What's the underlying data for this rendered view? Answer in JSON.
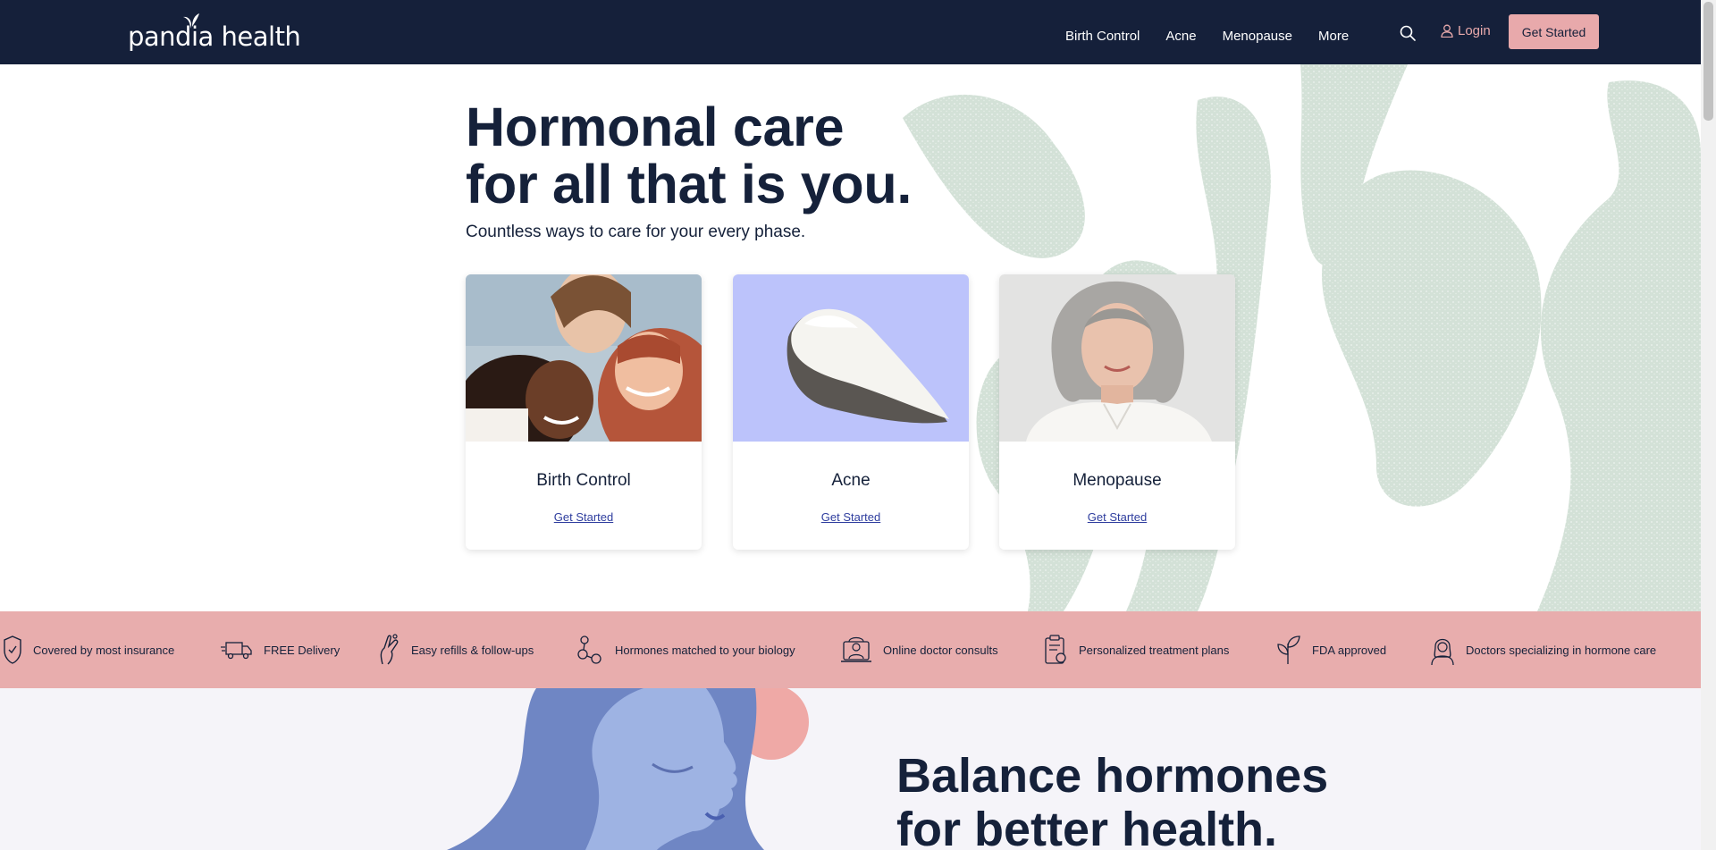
{
  "brand": {
    "logo_text": "pandia health",
    "nav_bg": "#15203a",
    "accent_pink": "#e8a9ab"
  },
  "nav": {
    "links": [
      "Birth Control",
      "Acne",
      "Menopause",
      "More"
    ],
    "login_label": "Login",
    "cta_label": "Get Started",
    "search_icon": "search-icon",
    "user_icon": "user-icon"
  },
  "hero": {
    "title_line1": "Hormonal care",
    "title_line2": "for all that is you.",
    "subtitle": "Countless ways to care for your every phase."
  },
  "cards": [
    {
      "title": "Birth Control",
      "link": "Get Started",
      "image": "group-of-smiling-women-photo"
    },
    {
      "title": "Acne",
      "link": "Get Started",
      "image": "cream-swatch-photo"
    },
    {
      "title": "Menopause",
      "link": "Get Started",
      "image": "older-woman-portrait-photo"
    }
  ],
  "features": [
    {
      "label": "Covered by most insurance",
      "icon": "shield-icon"
    },
    {
      "label": "FREE Delivery",
      "icon": "truck-icon"
    },
    {
      "label": "Easy refills & follow-ups",
      "icon": "hand-icon"
    },
    {
      "label": "Hormones matched to your biology",
      "icon": "molecule-icon"
    },
    {
      "label": "Online doctor consults",
      "icon": "laptop-doctor-icon"
    },
    {
      "label": "Personalized treatment plans",
      "icon": "clipboard-icon"
    },
    {
      "label": "FDA approved",
      "icon": "leaf-icon"
    },
    {
      "label": "Doctors specializing in hormone care",
      "icon": "doctor-icon"
    }
  ],
  "lower": {
    "title_line1": "Balance hormones",
    "title_line2": "for better health."
  }
}
